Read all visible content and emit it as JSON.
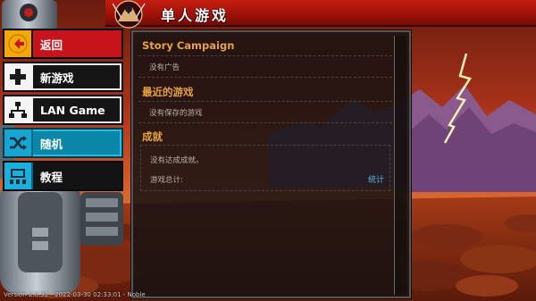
{
  "header": {
    "title": "单人游戏",
    "emblem_icon": "warrior-emblem-icon"
  },
  "menu": {
    "items": [
      {
        "label": "返回",
        "icon": "back-arrow-icon",
        "style": "back"
      },
      {
        "label": "新游戏",
        "icon": "plus-icon",
        "style": "white"
      },
      {
        "label": "LAN Game",
        "icon": "network-icon",
        "style": "white"
      },
      {
        "label": "随机",
        "icon": "shuffle-icon",
        "style": "teal"
      },
      {
        "label": "教程",
        "icon": "tutorial-icon",
        "style": "dark"
      }
    ]
  },
  "panel": {
    "story_title": "Story Campaign",
    "story_text": "没有广告",
    "recent_title": "最近的游戏",
    "recent_text": "没有保存的游戏",
    "achievements_title": "成就",
    "achievements_text": "没有达成成就。",
    "total_label": "游戏总计:",
    "total_link": "统计"
  },
  "footer": {
    "version": "Version 2.0.32 - 2022-03-30 02:33:01 - Noble"
  },
  "colors": {
    "banner_red": "#c41d10",
    "back_red": "#c6141a",
    "back_icon_bg": "#f2a800",
    "teal": "#0b86a8",
    "section_orange": "#e8a23e",
    "link_blue": "#58b4e8"
  }
}
